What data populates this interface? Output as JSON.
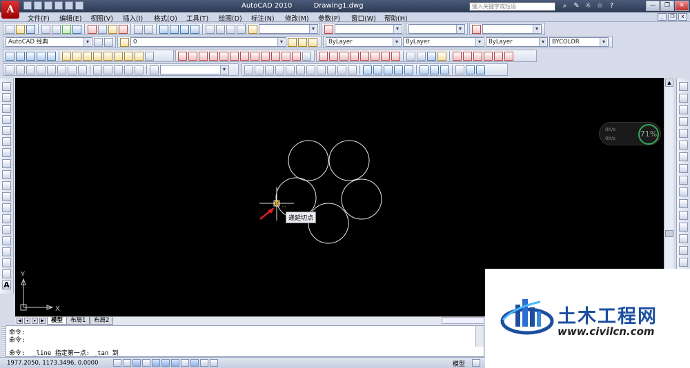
{
  "app": {
    "name": "AutoCAD 2010",
    "document": "Drawing1.dwg",
    "logo_letter": "A"
  },
  "search": {
    "placeholder": "键入关键字或短语"
  },
  "menu": [
    "文件(F)",
    "编辑(E)",
    "视图(V)",
    "插入(I)",
    "格式(O)",
    "工具(T)",
    "绘图(D)",
    "标注(N)",
    "修改(M)",
    "参数(P)",
    "窗口(W)",
    "帮助(H)"
  ],
  "toolbars": {
    "workspace": "AutoCAD 经典",
    "layer": "0",
    "color": "ByLayer",
    "linetype": "ByLayer",
    "lineweight": "ByLayer",
    "plotstyle": "BYCOLOR"
  },
  "canvas": {
    "background": "#000000",
    "tooltip": "递延切点",
    "ucs": {
      "x_label": "X",
      "y_label": "Y"
    }
  },
  "netmeter": {
    "up": "0K/s",
    "down": "0K/s",
    "percent": "71%"
  },
  "layout_tabs": [
    "模型",
    "布局1",
    "布局2"
  ],
  "command_history": [
    "命令:",
    "命令:"
  ],
  "command_line": "命令:  _line 指定第一点: _tan 到",
  "status": {
    "coords": "1977.2050, 1173.3496, 0.0000",
    "model_button": "模型"
  },
  "watermark": {
    "name": "土木工程网",
    "url": "www.civilcn.com"
  }
}
